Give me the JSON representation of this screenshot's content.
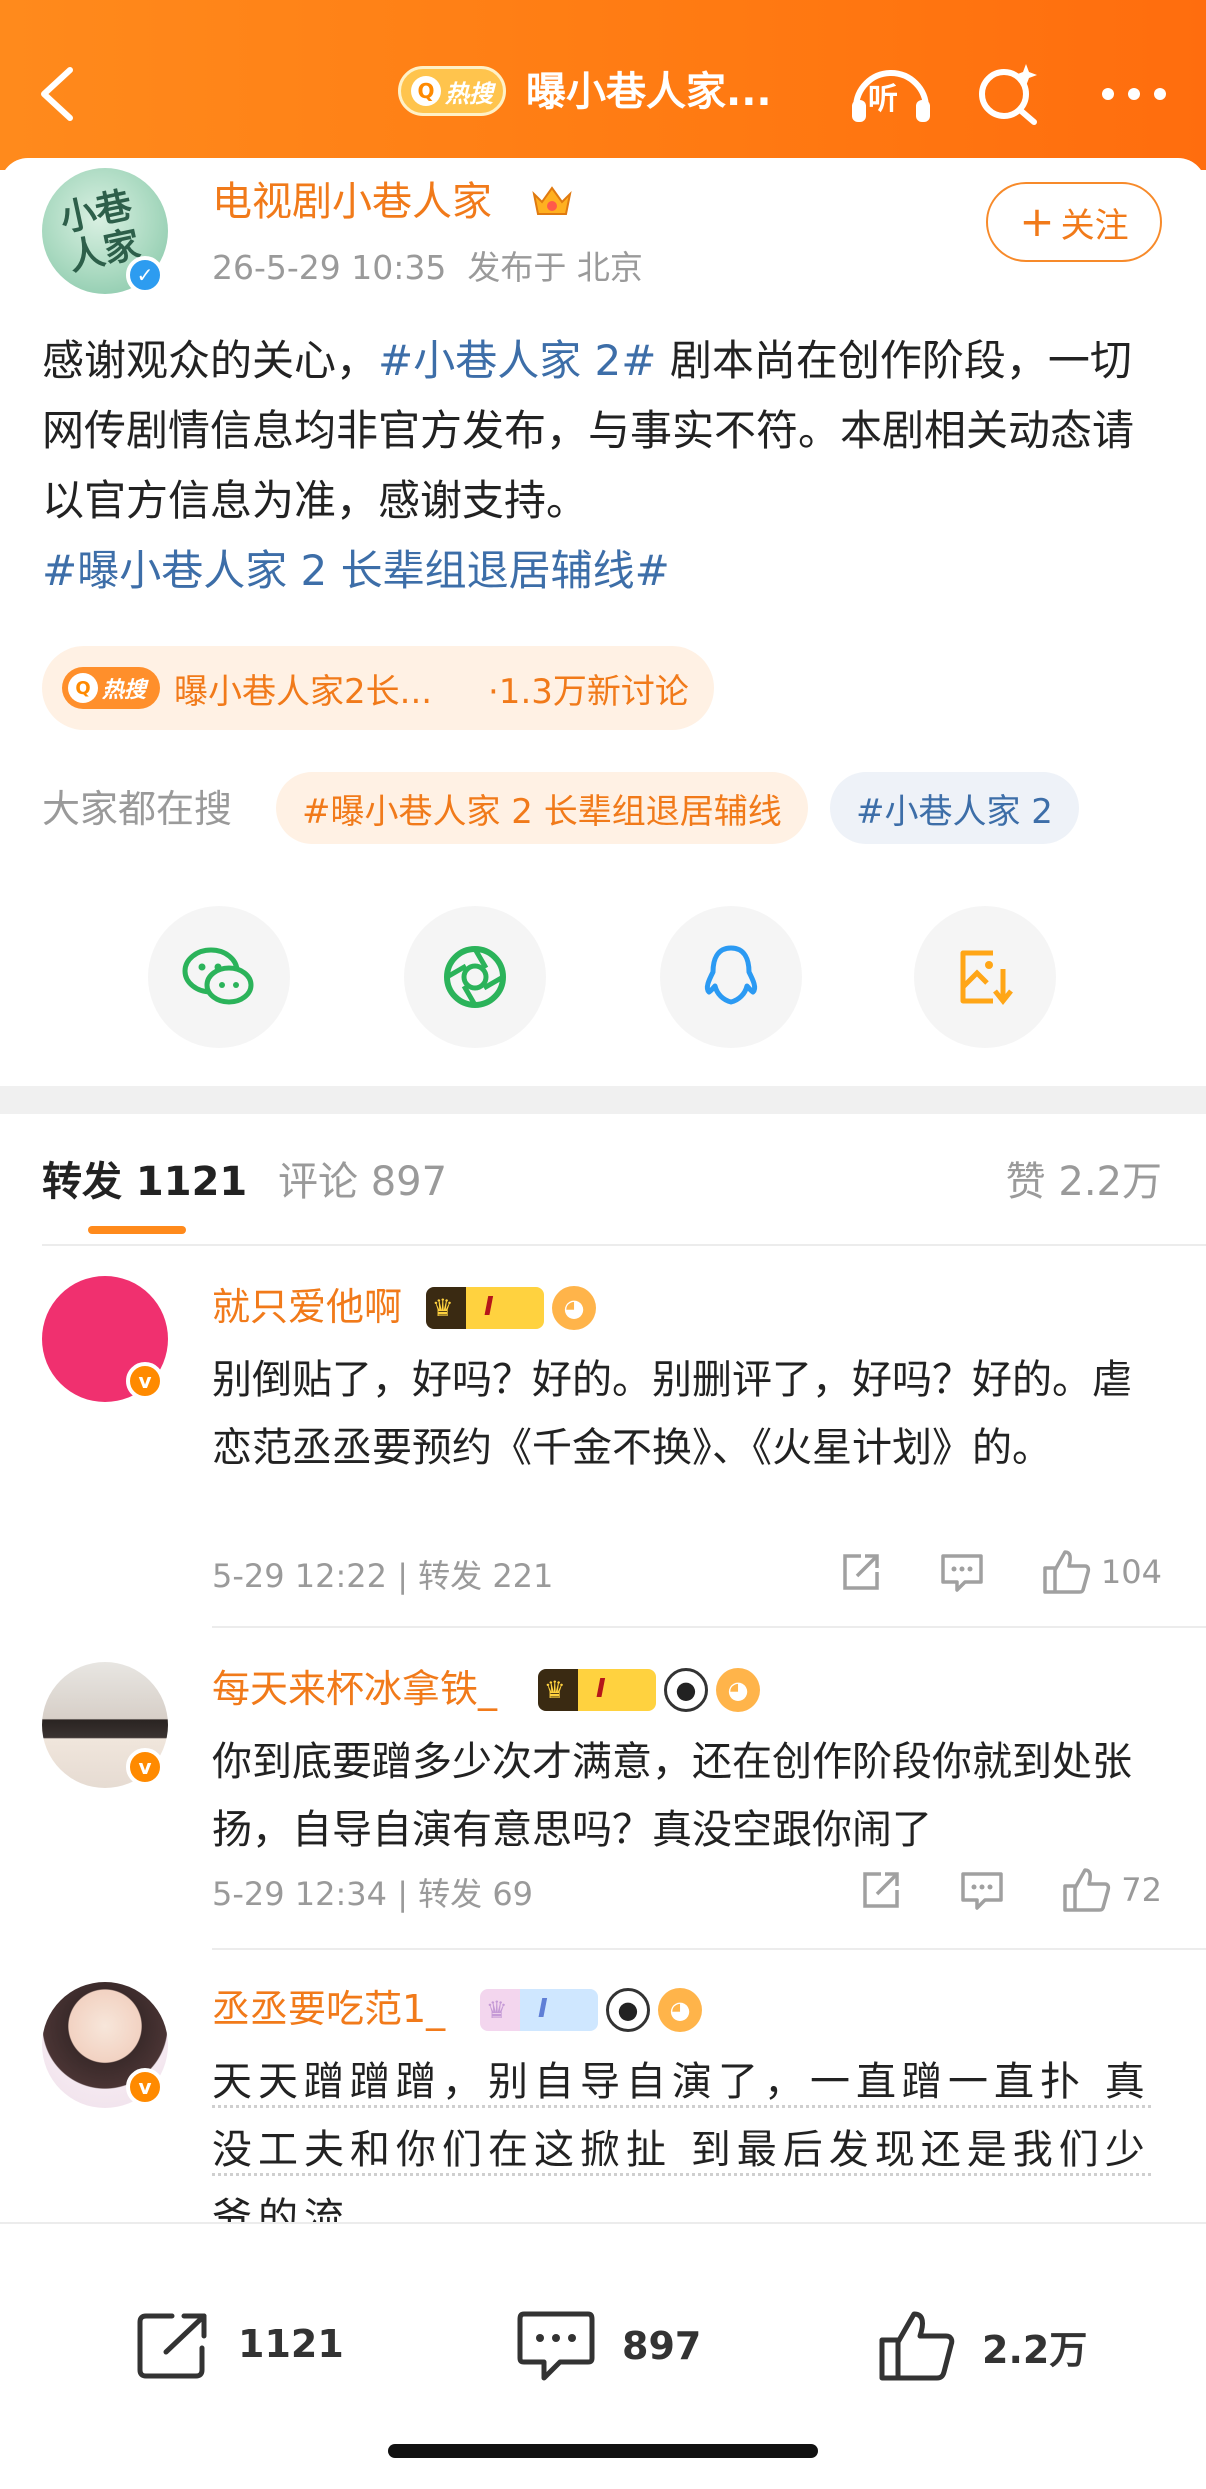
{
  "header": {
    "hot_tag": "热搜",
    "title": "曝小巷人家...",
    "listen_label": "听"
  },
  "post": {
    "author": "电视剧小巷人家",
    "time": "26-5-29 10:35",
    "location_text": "发布于 北京",
    "follow_label": "关注",
    "body_part1": "感谢观众的关心，",
    "body_tag1": "#小巷人家 2#",
    "body_part2": " 剧本尚在创作阶段，一切网传剧情信息均非官方发布，与事实不符。本剧相关动态请以官方信息为准，感谢支持。",
    "body_tag2": "#曝小巷人家 2 长辈组退居辅线#",
    "avatar_text": "小巷人家"
  },
  "hot_topic": {
    "badge": "热搜",
    "name": "曝小巷人家2长...",
    "count": "·1.3万新讨论"
  },
  "search": {
    "label": "大家都在搜",
    "chips": [
      "#曝小巷人家 2 长辈组退居辅线",
      "#小巷人家 2"
    ]
  },
  "share": {
    "icons": [
      "wechat-icon",
      "moments-icon",
      "qq-icon",
      "save-image-icon"
    ]
  },
  "tabs": {
    "repost": "转发 1121",
    "comment": "评论 897",
    "like": "赞 2.2万"
  },
  "comments": [
    {
      "name": "就只爱他啊",
      "text": "别倒贴了，好吗？好的。别删评了，好吗？好的。虐恋范丞丞要预约《千金不换》、《火星计划》的。",
      "meta": "5-29 12:22 | 转发 221",
      "likes": "104",
      "vip_level": "I"
    },
    {
      "name": "每天来杯冰拿铁_",
      "text": "你到底要蹭多少次才满意，还在创作阶段你就到处张扬，自导自演有意思吗？真没空跟你闹了",
      "meta": "5-29 12:34 | 转发 69",
      "likes": "72",
      "vip_level": "I"
    },
    {
      "name": "丞丞要吃范1_",
      "text": "天天蹭蹭蹭，别自导自演了，一直蹭一直扑 真没工夫和你们在这掀扯 到最后发现还是我们少爷的流",
      "vip_level": "I"
    }
  ],
  "bottom_bar": {
    "repost": "1121",
    "comment": "897",
    "like": "2.2万"
  },
  "colors": {
    "header_orange": "#ff7a12",
    "accent_orange": "#f17a1a",
    "tag_blue": "#3d6ea8",
    "gray_text": "#9a9a9a"
  }
}
